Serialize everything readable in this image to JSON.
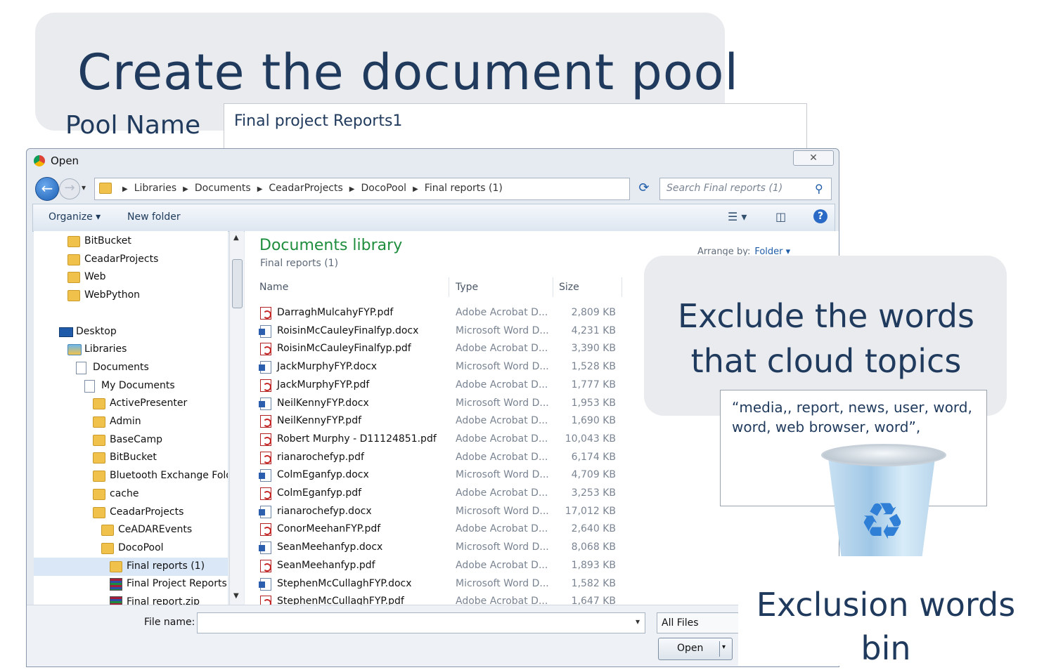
{
  "slide": {
    "title": "Create the document pool",
    "pool_name_label": "Pool Name",
    "pool_name_value": "Final project Reports1",
    "exclude_title": "Exclude the words that cloud topics",
    "exclude_words": "“media,, report, news,  user, word, word, web browser, word”,",
    "bin_label": "Exclusion words bin"
  },
  "dialog": {
    "title": "Open",
    "close_symbol": "✕",
    "breadcrumbs": [
      "Libraries",
      "Documents",
      "CeadarProjects",
      "DocoPool",
      "Final reports (1)"
    ],
    "search_placeholder": "Search Final reports (1)",
    "toolbar": {
      "organize": "Organize ▾",
      "new_folder": "New folder"
    },
    "nav_items": [
      {
        "label": "BitBucket",
        "icon": "folder-icon",
        "indent": 1
      },
      {
        "label": "CeadarProjects",
        "icon": "folder-icon",
        "indent": 1
      },
      {
        "label": "Web",
        "icon": "folder-icon",
        "indent": 1
      },
      {
        "label": "WebPython",
        "icon": "folder-icon",
        "indent": 1
      },
      {
        "label": "",
        "icon": "",
        "indent": 0
      },
      {
        "label": "Desktop",
        "icon": "desktop-icon",
        "indent": 0
      },
      {
        "label": "Libraries",
        "icon": "libraries-icon",
        "indent": 1
      },
      {
        "label": "Documents",
        "icon": "document-icon",
        "indent": 2
      },
      {
        "label": "My Documents",
        "icon": "document-icon",
        "indent": 3
      },
      {
        "label": "ActivePresenter",
        "icon": "folder-icon",
        "indent": 4
      },
      {
        "label": "Admin",
        "icon": "folder-icon",
        "indent": 4
      },
      {
        "label": "BaseCamp",
        "icon": "folder-icon",
        "indent": 4
      },
      {
        "label": "BitBucket",
        "icon": "folder-icon",
        "indent": 4
      },
      {
        "label": "Bluetooth Exchange Folder",
        "icon": "folder-icon",
        "indent": 4
      },
      {
        "label": "cache",
        "icon": "folder-icon",
        "indent": 4
      },
      {
        "label": "CeadarProjects",
        "icon": "folder-icon",
        "indent": 4
      },
      {
        "label": "CeADAREvents",
        "icon": "folder-icon",
        "indent": 5
      },
      {
        "label": "DocoPool",
        "icon": "folder-icon",
        "indent": 5
      },
      {
        "label": "Final reports (1)",
        "icon": "folder-icon",
        "indent": 6,
        "selected": true
      },
      {
        "label": "Final Project Reports.zip",
        "icon": "zip-icon",
        "indent": 6
      },
      {
        "label": "Final report.zip",
        "icon": "zip-icon",
        "indent": 6
      }
    ],
    "library_title": "Documents library",
    "library_subtitle": "Final reports (1)",
    "arrange_label": "Arrange by:",
    "arrange_value": "Folder ▾",
    "columns": {
      "name": "Name",
      "type": "Type",
      "size": "Size"
    },
    "files": [
      {
        "name": "DarraghMulcahyFYP.pdf",
        "type": "Adobe Acrobat D...",
        "size": "2,809 KB",
        "kind": "pdf"
      },
      {
        "name": "RoisinMcCauleyFinalfyp.docx",
        "type": "Microsoft Word D...",
        "size": "4,231 KB",
        "kind": "doc"
      },
      {
        "name": "RoisinMcCauleyFinalfyp.pdf",
        "type": "Adobe Acrobat D...",
        "size": "3,390 KB",
        "kind": "pdf"
      },
      {
        "name": "JackMurphyFYP.docx",
        "type": "Microsoft Word D...",
        "size": "1,528 KB",
        "kind": "doc"
      },
      {
        "name": "JackMurphyFYP.pdf",
        "type": "Adobe Acrobat D...",
        "size": "1,777 KB",
        "kind": "pdf"
      },
      {
        "name": "NeilKennyFYP.docx",
        "type": "Microsoft Word D...",
        "size": "1,953 KB",
        "kind": "doc"
      },
      {
        "name": "NeilKennyFYP.pdf",
        "type": "Adobe Acrobat D...",
        "size": "1,690 KB",
        "kind": "pdf"
      },
      {
        "name": "Robert Murphy - D11124851.pdf",
        "type": "Adobe Acrobat D...",
        "size": "10,043 KB",
        "kind": "pdf"
      },
      {
        "name": "rianarochefyp.pdf",
        "type": "Adobe Acrobat D...",
        "size": "6,174 KB",
        "kind": "pdf"
      },
      {
        "name": "ColmEganfyp.docx",
        "type": "Microsoft Word D...",
        "size": "4,709 KB",
        "kind": "doc"
      },
      {
        "name": "ColmEganfyp.pdf",
        "type": "Adobe Acrobat D...",
        "size": "3,253 KB",
        "kind": "pdf"
      },
      {
        "name": "rianarochefyp.docx",
        "type": "Microsoft Word D...",
        "size": "17,012 KB",
        "kind": "doc"
      },
      {
        "name": "ConorMeehanFYP.pdf",
        "type": "Adobe Acrobat D...",
        "size": "2,640 KB",
        "kind": "pdf"
      },
      {
        "name": "SeanMeehanfyp.docx",
        "type": "Microsoft Word D...",
        "size": "8,068 KB",
        "kind": "doc"
      },
      {
        "name": "SeanMeehanfyp.pdf",
        "type": "Adobe Acrobat D...",
        "size": "1,893 KB",
        "kind": "pdf"
      },
      {
        "name": "StephenMcCullaghFYP.docx",
        "type": "Microsoft Word D...",
        "size": "1,582 KB",
        "kind": "doc"
      },
      {
        "name": "StephenMcCullaghFYP.pdf",
        "type": "Adobe Acrobat D...",
        "size": "1,647 KB",
        "kind": "pdf"
      }
    ],
    "file_name_label": "File name:",
    "file_name_value": "",
    "filter_label": "All Files",
    "open_button": "Open"
  },
  "colors": {
    "title_text": "#1f3a5c",
    "library_title": "#1e8e3e",
    "callout_bg": "#e9ebee"
  }
}
